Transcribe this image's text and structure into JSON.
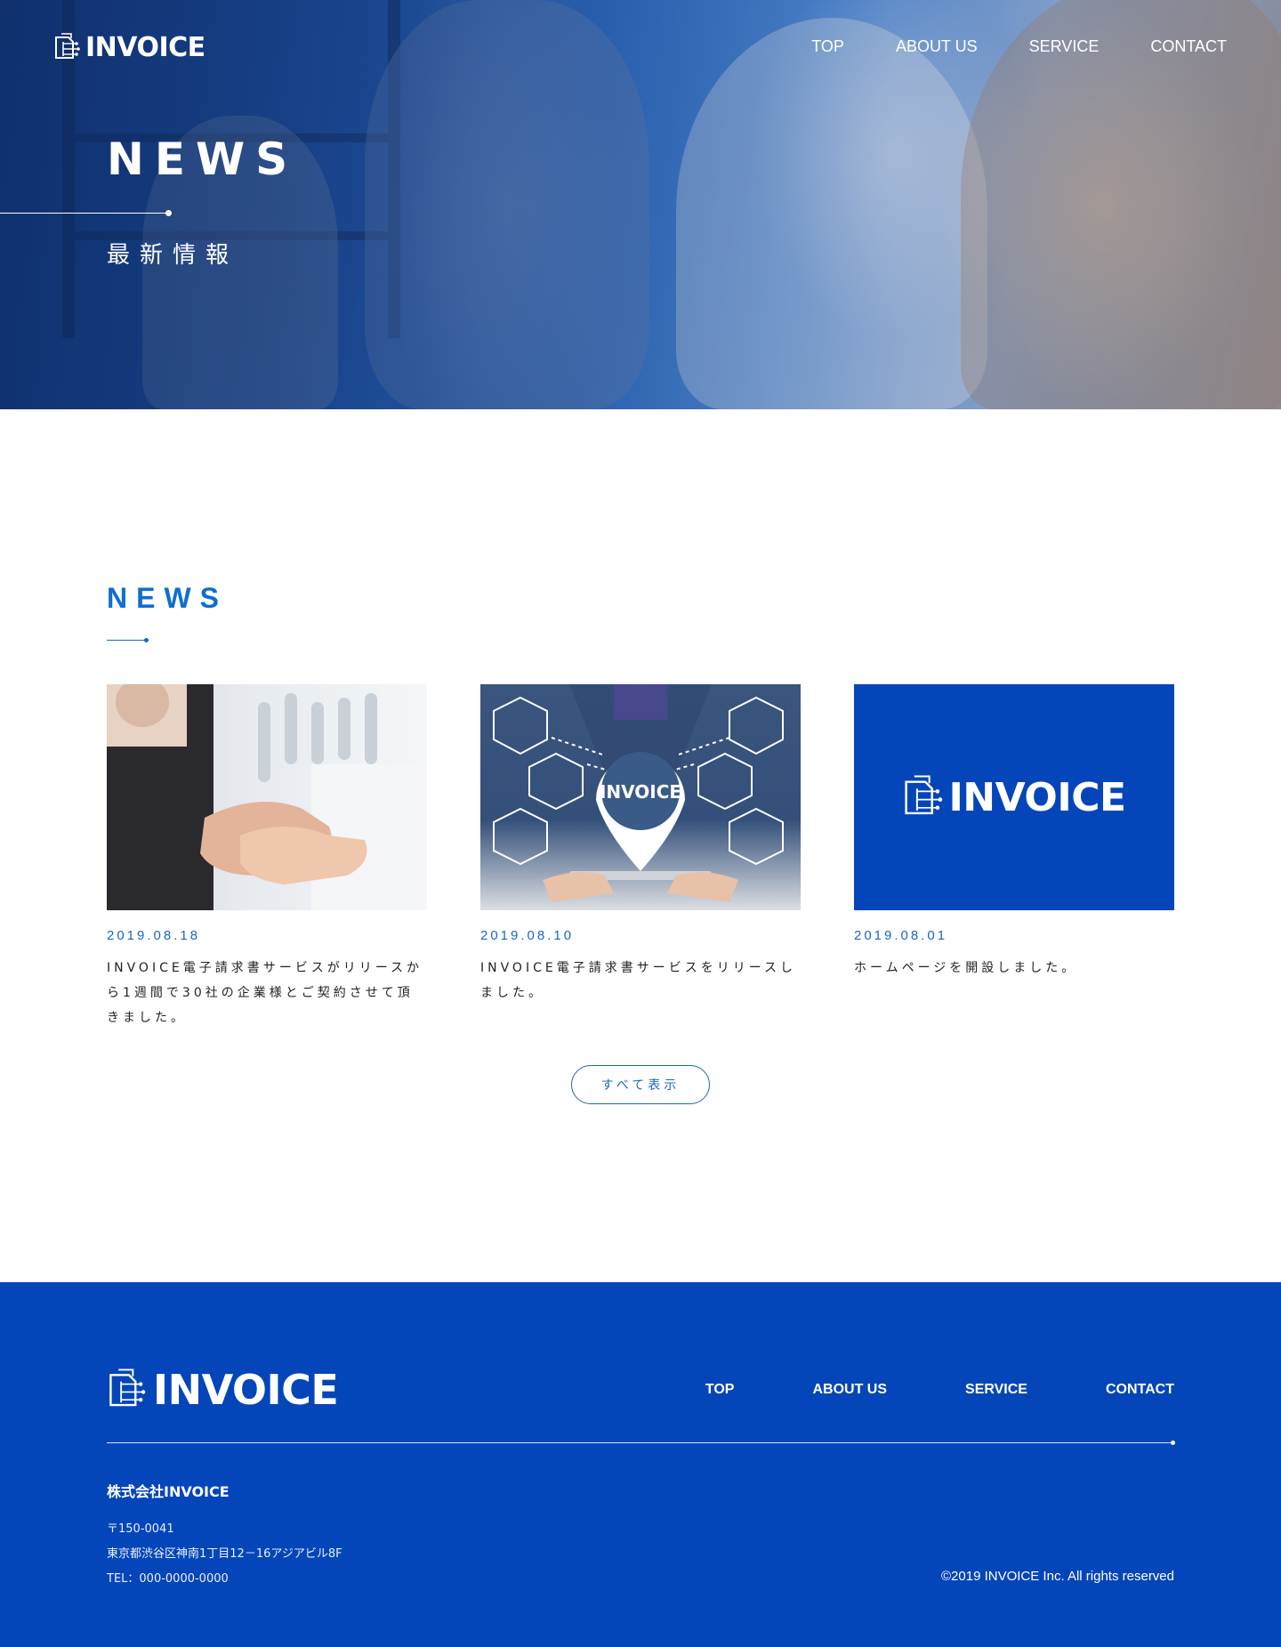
{
  "header": {
    "brand": "INVOICE",
    "nav": [
      "TOP",
      "ABOUT US",
      "SERVICE",
      "CONTACT"
    ]
  },
  "hero": {
    "title": "NEWS",
    "subtitle": "最新情報"
  },
  "news": {
    "heading": "NEWS",
    "items": [
      {
        "date": "2019.08.18",
        "text": "INVOICE電子請求書サービスがリリースから1週間で30社の企業様とご契約させて頂きました。"
      },
      {
        "date": "2019.08.10",
        "text": "INVOICE電子請求書サービスをリリースしました。",
        "image_label": "INVOICE"
      },
      {
        "date": "2019.08.01",
        "text": "ホームページを開設しました。",
        "image_label": "INVOICE"
      }
    ],
    "view_all": "すべて表示"
  },
  "footer": {
    "brand": "INVOICE",
    "nav": [
      "TOP",
      "ABOUT US",
      "SERVICE",
      "CONTACT"
    ],
    "company": "株式会社INVOICE",
    "postal": "〒150-0041",
    "address": "東京都渋谷区神南1丁目12－16アジアビル8F",
    "tel": "TEL：000-0000-0000",
    "copyright": "©2019 INVOICE Inc. All rights reserved"
  },
  "colors": {
    "brand_blue": "#0446b9",
    "accent_blue": "#1a66c8"
  }
}
